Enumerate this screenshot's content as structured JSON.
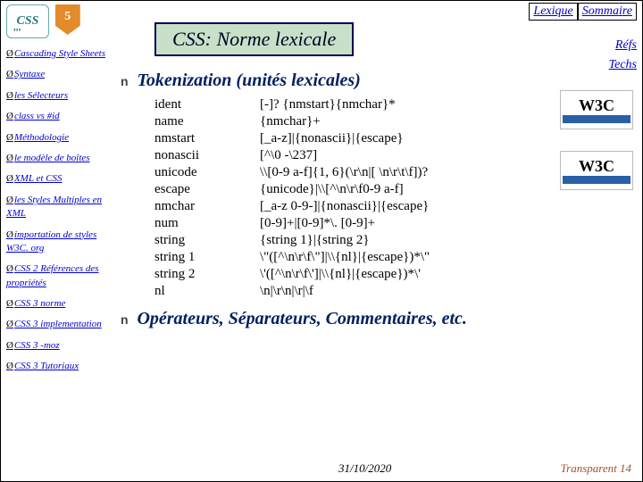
{
  "logo_text": "CSS",
  "shield_text": "5",
  "title": "CSS: Norme lexicale",
  "top_links": {
    "lexique": "Lexique",
    "sommaire": "Sommaire"
  },
  "side_links": {
    "refs": "Réfs",
    "techs": "Techs"
  },
  "nav": [
    "Cascading Style Sheets",
    "Syntaxe",
    "les Sélecteurs",
    "class vs #id",
    "Méthodologie",
    "le modèle de boîtes",
    "XML et CSS",
    "les Styles Multiples en XML",
    "importation de styles W3C. org",
    "CSS 2 Références des propriétés",
    "CSS 3 norme",
    "CSS 3 implementation",
    "CSS 3 -moz",
    "CSS 3 Tutoriaux"
  ],
  "section1_title": "Tokenization (unités lexicales)",
  "tokens": [
    {
      "k": "ident",
      "v": "[-]? {nmstart}{nmchar}*"
    },
    {
      "k": "name",
      "v": "{nmchar}+"
    },
    {
      "k": "nmstart",
      "v": "[_a-z]|{nonascii}|{escape}"
    },
    {
      "k": "nonascii",
      "v": "[^\\0 -\\237]"
    },
    {
      "k": "unicode",
      "v": "\\\\[0-9 a-f]{1, 6}(\\r\\n|[ \\n\\r\\t\\f])?"
    },
    {
      "k": "escape",
      "v": "{unicode}|\\\\[^\\n\\r\\f0-9 a-f]"
    },
    {
      "k": "nmchar",
      "v": "[_a-z 0-9-]|{nonascii}|{escape}"
    },
    {
      "k": "num",
      "v": "[0-9]+|[0-9]*\\. [0-9]+"
    },
    {
      "k": "string",
      "v": "{string 1}|{string 2}"
    },
    {
      "k": "string 1",
      "v": "\\\"([^\\n\\r\\f\\\"]|\\\\{nl}|{escape})*\\\""
    },
    {
      "k": "string 2",
      "v": "\\'([^\\n\\r\\f\\']|\\\\{nl}|{escape})*\\'"
    },
    {
      "k": "nl",
      "v": "\\n|\\r\\n|\\r|\\f"
    }
  ],
  "section2_title": "Opérateurs, Séparateurs, Commentaires, etc.",
  "w3c_label": "W3C",
  "footer": {
    "date": "31/10/2020",
    "page": "Transparent 14"
  }
}
